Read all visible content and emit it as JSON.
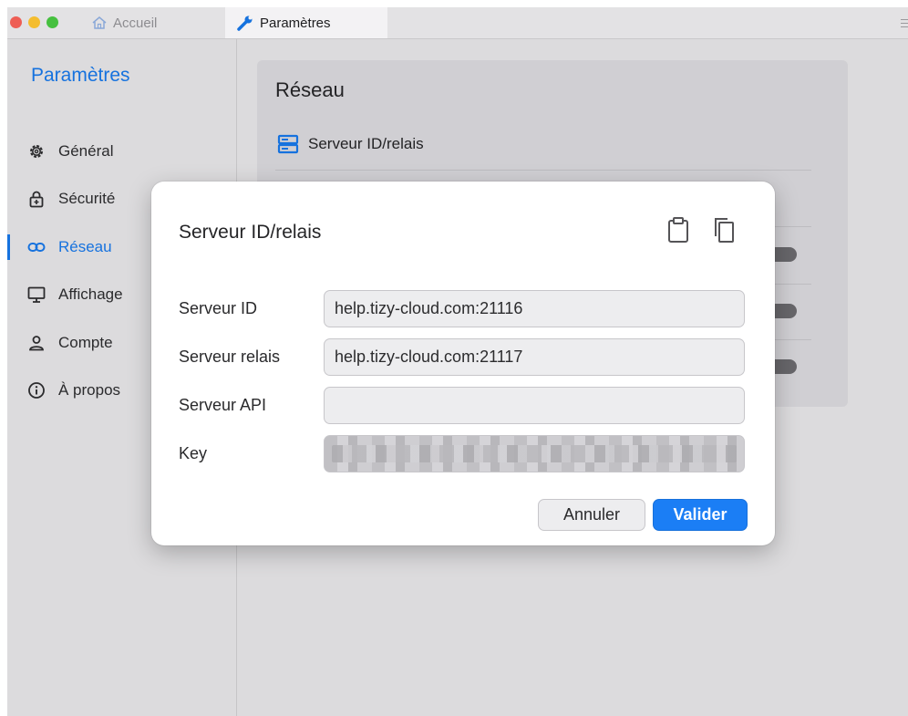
{
  "tabs": {
    "home_label": "Accueil",
    "settings_label": "Paramètres"
  },
  "sidebar": {
    "title": "Paramètres",
    "items": [
      {
        "label": "Général",
        "icon": "gear-icon"
      },
      {
        "label": "Sécurité",
        "icon": "lock-icon"
      },
      {
        "label": "Réseau",
        "icon": "link-icon",
        "active": true
      },
      {
        "label": "Affichage",
        "icon": "monitor-icon"
      },
      {
        "label": "Compte",
        "icon": "user-icon"
      },
      {
        "label": "À propos",
        "icon": "info-icon"
      }
    ]
  },
  "content": {
    "title": "Réseau",
    "row_label": "Serveur ID/relais"
  },
  "dialog": {
    "title": "Serveur ID/relais",
    "fields": [
      {
        "label": "Serveur ID",
        "value": "help.tizy-cloud.com:21116"
      },
      {
        "label": "Serveur relais",
        "value": "help.tizy-cloud.com:21117"
      },
      {
        "label": "Serveur API",
        "value": ""
      },
      {
        "label": "Key",
        "value": ""
      }
    ],
    "cancel_label": "Annuler",
    "ok_label": "Valider"
  },
  "colors": {
    "accent": "#1672de",
    "primary_button": "#1b7ef5"
  }
}
